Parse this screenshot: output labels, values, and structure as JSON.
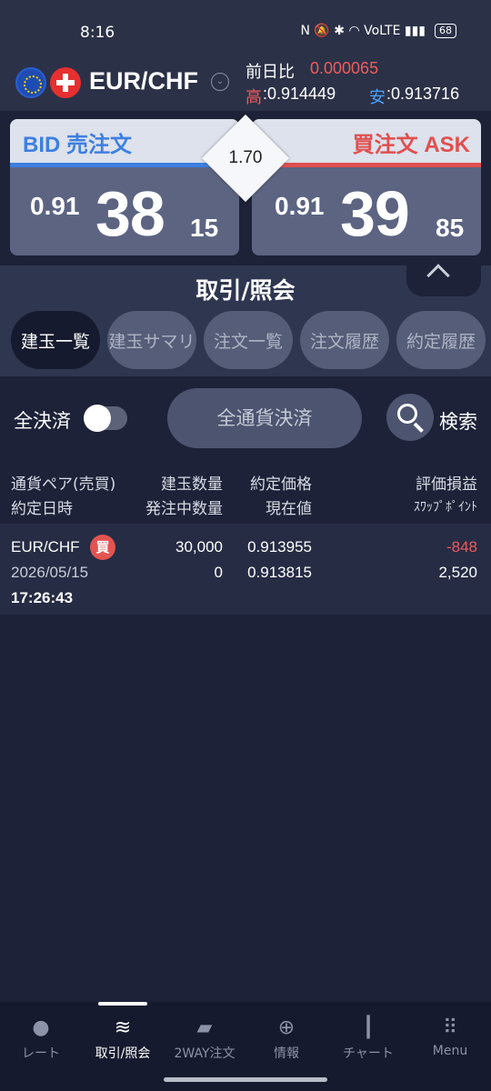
{
  "status_bar": {
    "time": "8:16",
    "network_icons": "N 🔕 ✱ ◠ VoLTE ▮▮▮",
    "battery": "68"
  },
  "header": {
    "pair": "EUR/CHF",
    "prev_day_label": "前日比",
    "prev_day_value": "0.000065",
    "high_label": "高",
    "high_value": ":0.914449",
    "low_label": "安",
    "low_value": ":0.913716"
  },
  "bid": {
    "label": "BID 売注文",
    "price_prefix": "0.91",
    "price_main": "38",
    "price_small": "15"
  },
  "ask": {
    "label": "買注文 ASK",
    "price_prefix": "0.91",
    "price_main": "39",
    "price_small": "85"
  },
  "spread": "1.70",
  "section_title": "取引/照会",
  "tabs": [
    {
      "label": "建玉一覧"
    },
    {
      "label": "建玉サマリ"
    },
    {
      "label": "注文一覧"
    },
    {
      "label": "注文履歴"
    },
    {
      "label": "約定履歴"
    }
  ],
  "controls": {
    "close_all_toggle_label": "全決済",
    "close_all_currency_button": "全通貨決済",
    "search_label": "検索"
  },
  "table_headers": {
    "col1_line1": "通貨ペア(売買)",
    "col1_line2": "約定日時",
    "col2_line1": "建玉数量",
    "col2_line2": "発注中数量",
    "col3_line1": "約定価格",
    "col3_line2": "現在値",
    "col4_line1": "評価損益",
    "col4_line2": "ｽﾜｯﾌﾟﾎﾟｲﾝﾄ"
  },
  "positions": [
    {
      "pair": "EUR/CHF",
      "side_badge": "買",
      "date": "2026/05/15",
      "time": "17:26:43",
      "quantity": "30,000",
      "pending_quantity": "0",
      "contract_price": "0.913955",
      "current_price": "0.913815",
      "pnl": "-848",
      "swap_points": "2,520"
    }
  ],
  "bottom_nav": [
    {
      "label": "レート",
      "icon": "rate-icon"
    },
    {
      "label": "取引/照会",
      "icon": "trade-icon"
    },
    {
      "label": "2WAY注文",
      "icon": "twoway-icon"
    },
    {
      "label": "情報",
      "icon": "info-icon"
    },
    {
      "label": "チャート",
      "icon": "chart-icon"
    },
    {
      "label": "Menu",
      "icon": "menu-grid-icon"
    }
  ],
  "colors": {
    "bid_blue": "#3d7fe0",
    "ask_red": "#e04f4f",
    "background": "#1d2238",
    "negative": "#ef5b5b"
  }
}
